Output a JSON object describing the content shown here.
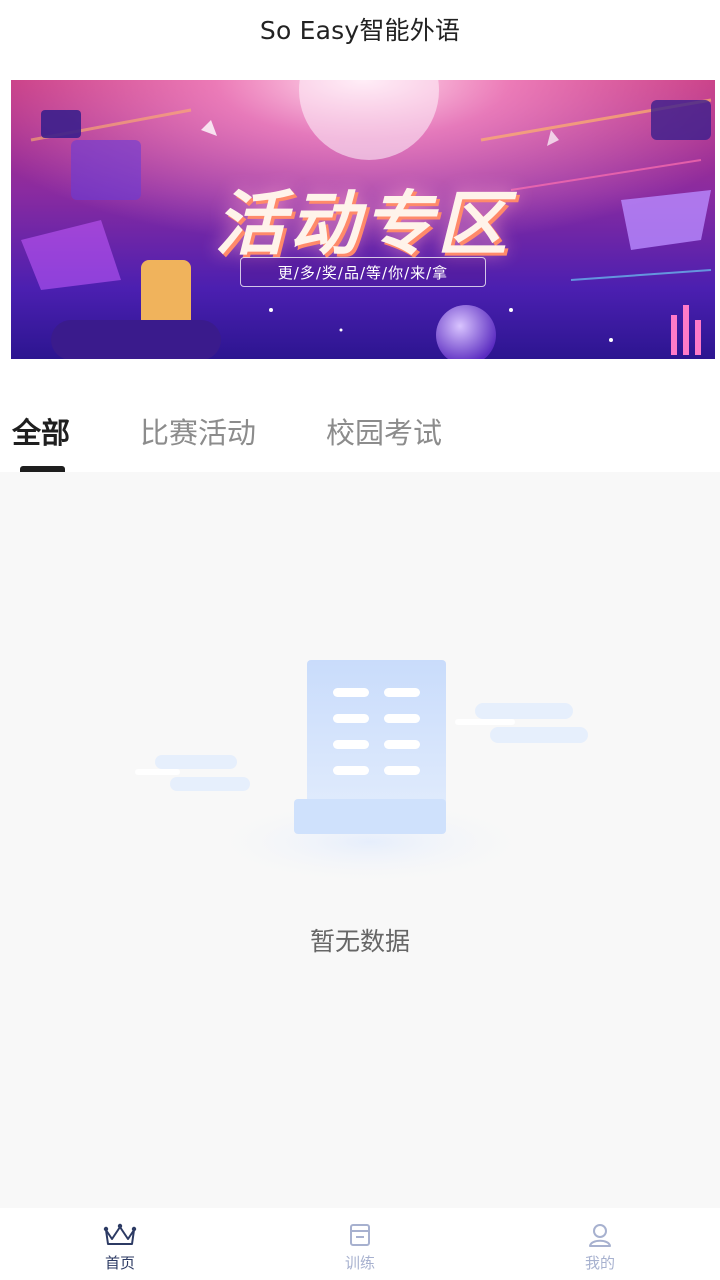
{
  "header": {
    "title": "So Easy智能外语"
  },
  "banner": {
    "title": "活动专区",
    "subtitle": "更/多/奖/品/等/你/来/拿"
  },
  "tabs": [
    {
      "label": "全部",
      "active": true
    },
    {
      "label": "比赛活动",
      "active": false
    },
    {
      "label": "校园考试",
      "active": false
    }
  ],
  "empty_state": {
    "text": "暂无数据",
    "icon": "empty-document-icon"
  },
  "bottom_nav": [
    {
      "label": "首页",
      "icon": "crown-icon",
      "active": true
    },
    {
      "label": "训练",
      "icon": "training-icon",
      "active": false
    },
    {
      "label": "我的",
      "icon": "user-icon",
      "active": false
    }
  ],
  "colors": {
    "nav_active": "#2c3a63",
    "nav_inactive": "#a7b1cf",
    "content_bg": "#f8f8f8",
    "illustration_blue": "#cfe2fc"
  }
}
